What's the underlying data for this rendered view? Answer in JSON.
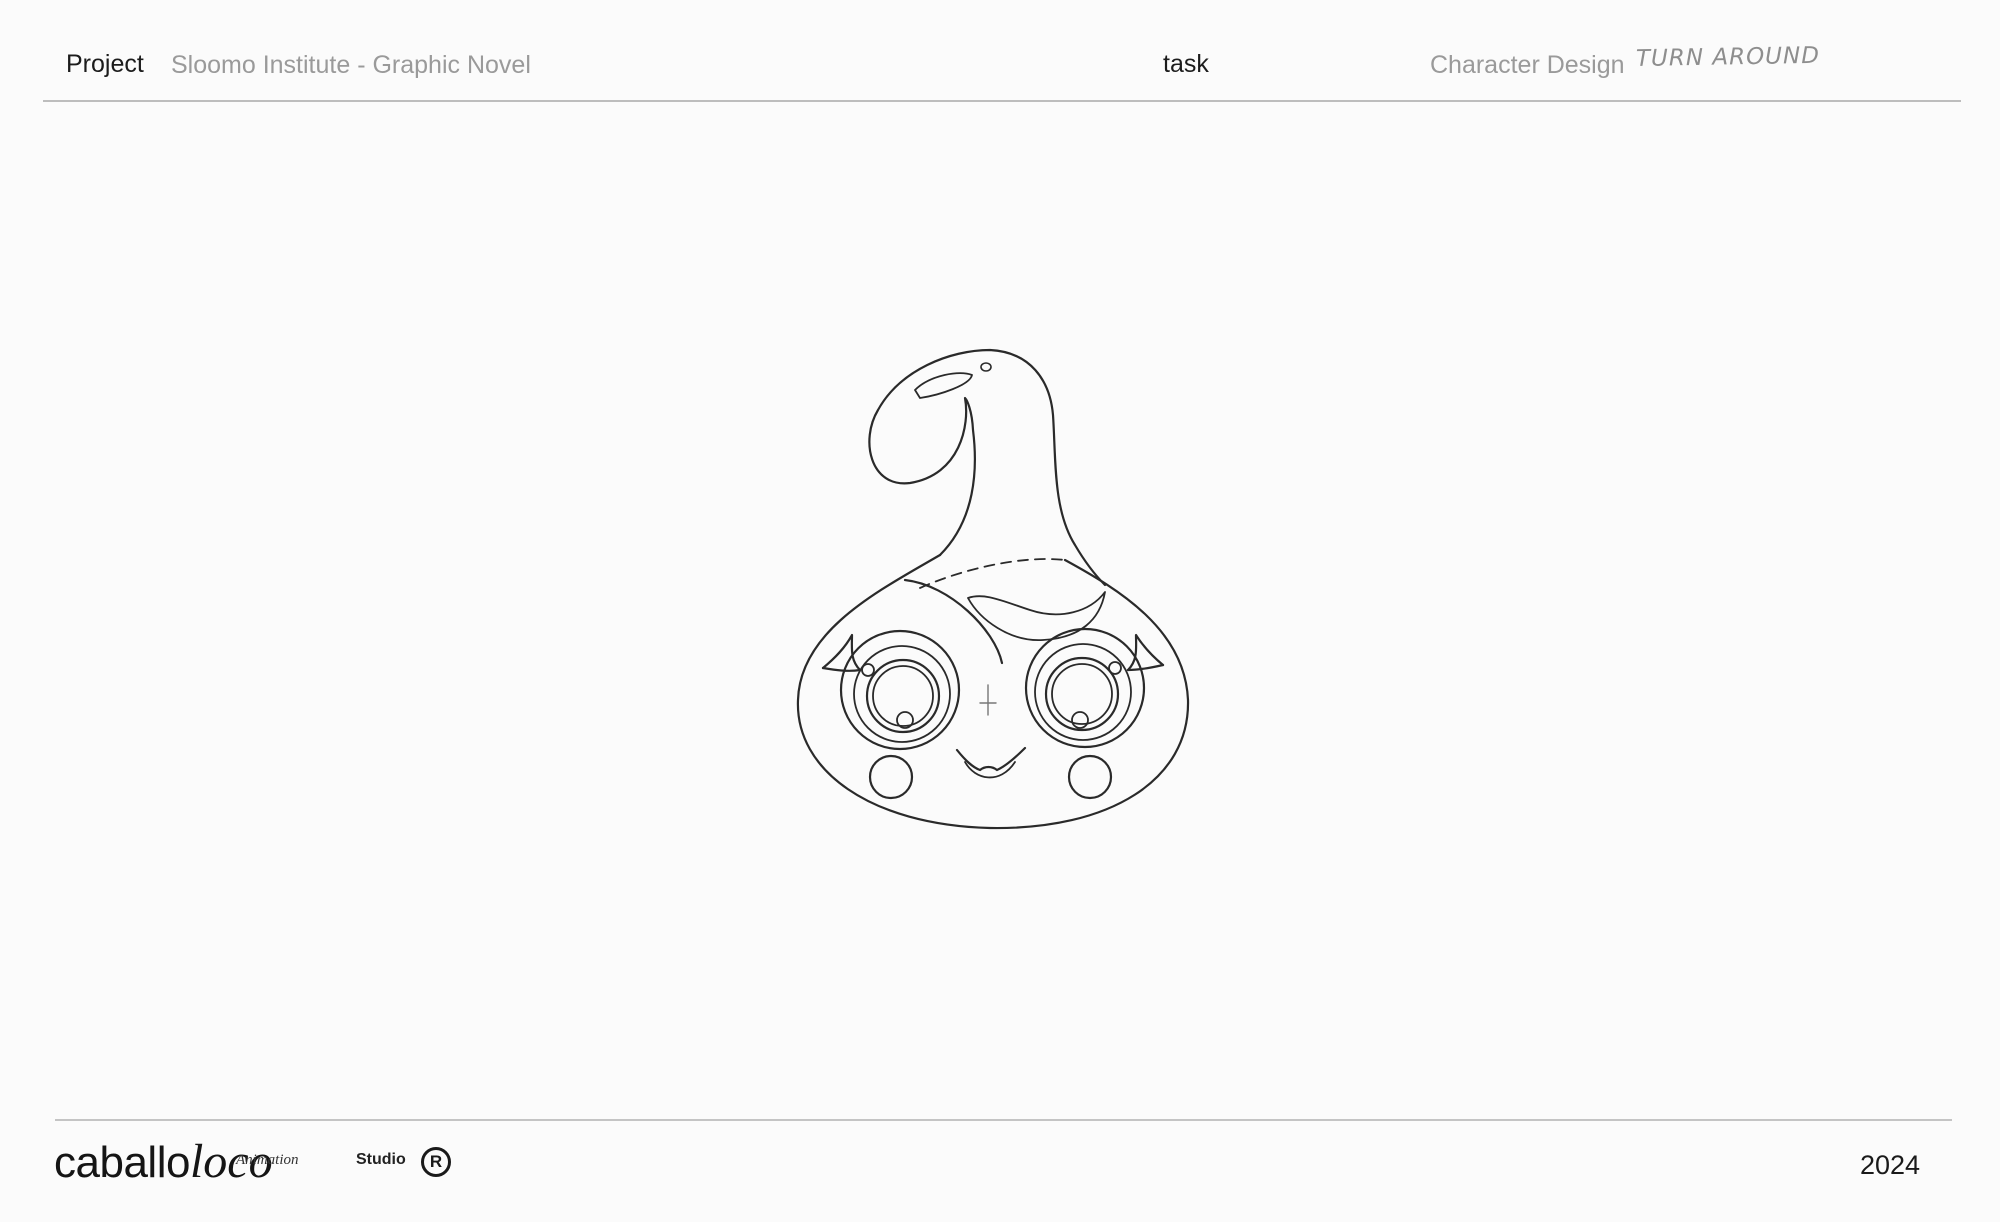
{
  "header": {
    "project_label": "Project",
    "project_value": "Sloomo Institute - Graphic Novel",
    "task_label": "task",
    "task_value": "Character Design",
    "task_note": "TURN AROUND"
  },
  "drawing": {
    "icon": "character-sketch"
  },
  "footer": {
    "logo_main": "caballo",
    "logo_italic": "loco",
    "logo_sub_italic": "Animation",
    "logo_sub": "Studio",
    "reg_symbol": "R",
    "year": "2024"
  },
  "colors": {
    "background": "#fbfbfb",
    "text": "#1a1a1a",
    "muted": "#9a9a9a",
    "rule": "#bdbdbd"
  }
}
